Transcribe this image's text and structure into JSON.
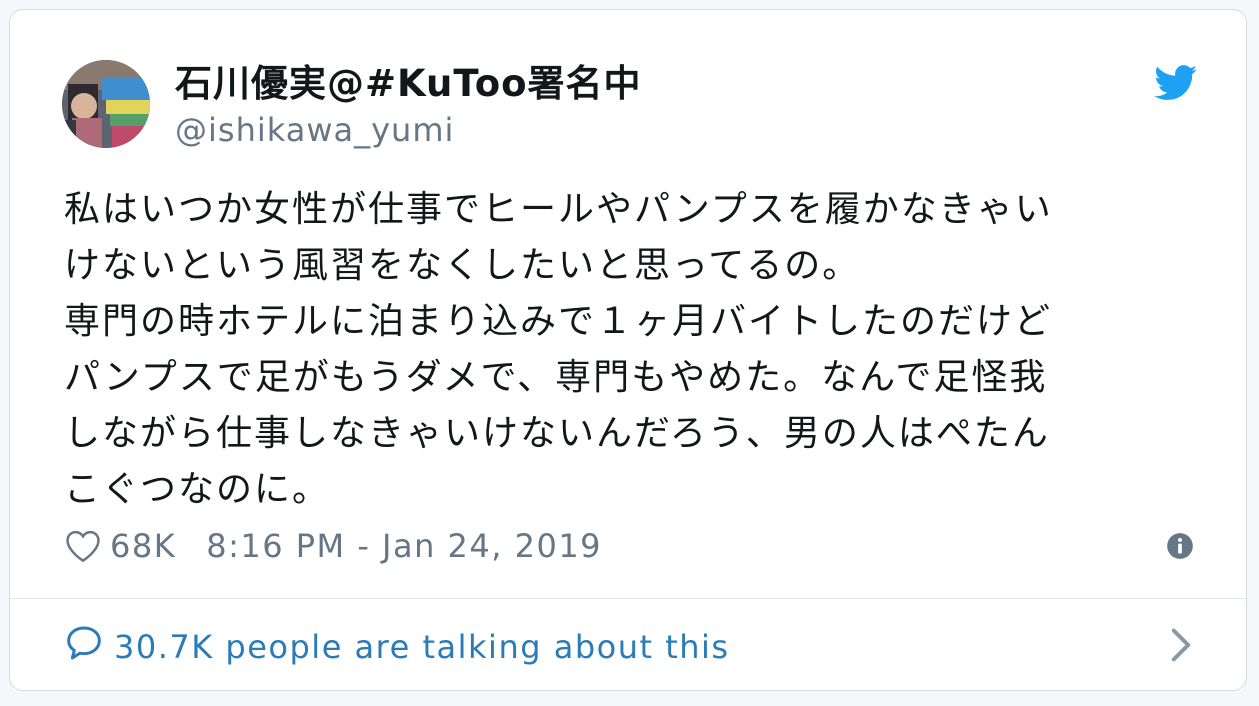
{
  "user": {
    "display_name": "石川優実@#KuToo署名中",
    "handle": "@ishikawa_yumi"
  },
  "tweet": {
    "lines": [
      "私はいつか女性が仕事でヒールやパンプスを履かなきゃい",
      "けないという風習をなくしたいと思ってるの。",
      "専門の時ホテルに泊まり込みで１ヶ月バイトしたのだけど",
      "パンプスで足がもうダメで、専門もやめた。なんで足怪我",
      "しながら仕事しなきゃいけないんだろう、男の人はぺたん",
      "こぐつなのに。"
    ]
  },
  "meta": {
    "likes": "68K",
    "timestamp": "8:16 PM - Jan 24, 2019"
  },
  "footer": {
    "talking_text": "30.7K people are talking about this"
  },
  "icons": {
    "brand": "twitter-bird-icon",
    "like": "heart-icon",
    "info": "info-icon",
    "reply": "speech-bubble-icon",
    "more": "chevron-right-icon"
  },
  "colors": {
    "twitter_blue": "#1da1f2",
    "link_blue": "#2b7bb9",
    "secondary_text": "#657786",
    "primary_text": "#14171a",
    "border": "#e1e8ed"
  }
}
